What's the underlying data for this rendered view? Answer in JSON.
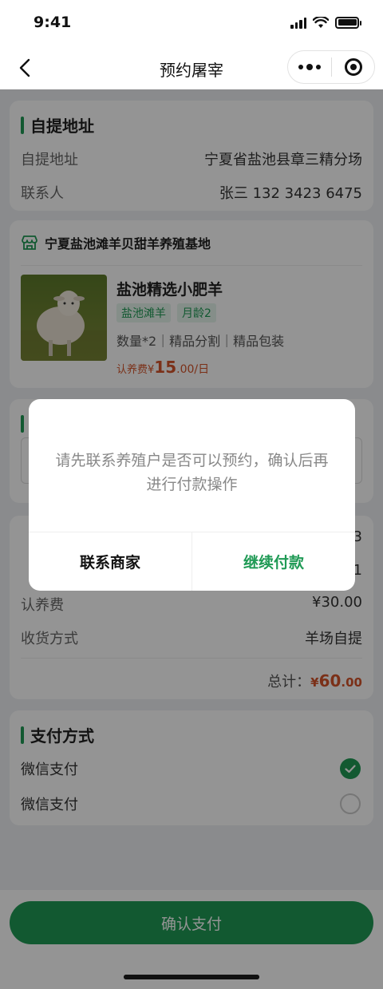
{
  "status_bar": {
    "time": "9:41"
  },
  "nav": {
    "title": "预约屠宰"
  },
  "pickup": {
    "title": "自提地址",
    "address_label": "自提地址",
    "address_value": "宁夏省盐池县章三精分场",
    "contact_label": "联系人",
    "contact_value": "张三 132 3423 6475"
  },
  "product": {
    "shop_name": "宁夏盐池滩羊贝甜羊养殖基地",
    "name": "盐池精选小肥羊",
    "tags": [
      "盐池滩羊",
      "月龄2"
    ],
    "specs": "数量*2｜精品分割｜精品包装",
    "price_label": "认养费",
    "price_currency": "¥",
    "price_integer": "15",
    "price_decimal": ".00",
    "price_unit": "/日"
  },
  "order": {
    "row1_value": "3",
    "row2_value": "1",
    "fee_label": "认养费",
    "fee_value": "¥30.00",
    "delivery_label": "收货方式",
    "delivery_value": "羊场自提",
    "total_label": "总计：",
    "total_currency": "¥",
    "total_integer": "60",
    "total_decimal": ".00"
  },
  "payment": {
    "title": "支付方式",
    "methods": [
      {
        "label": "微信支付",
        "selected": true
      },
      {
        "label": "微信支付",
        "selected": false
      }
    ]
  },
  "bottom": {
    "confirm_label": "确认支付"
  },
  "modal": {
    "message": "请先联系养殖户是否可以预约，确认后再进行付款操作",
    "left_button": "联系商家",
    "right_button": "继续付款"
  },
  "colors": {
    "accent": "#1f9a55",
    "price": "#d4542a"
  }
}
